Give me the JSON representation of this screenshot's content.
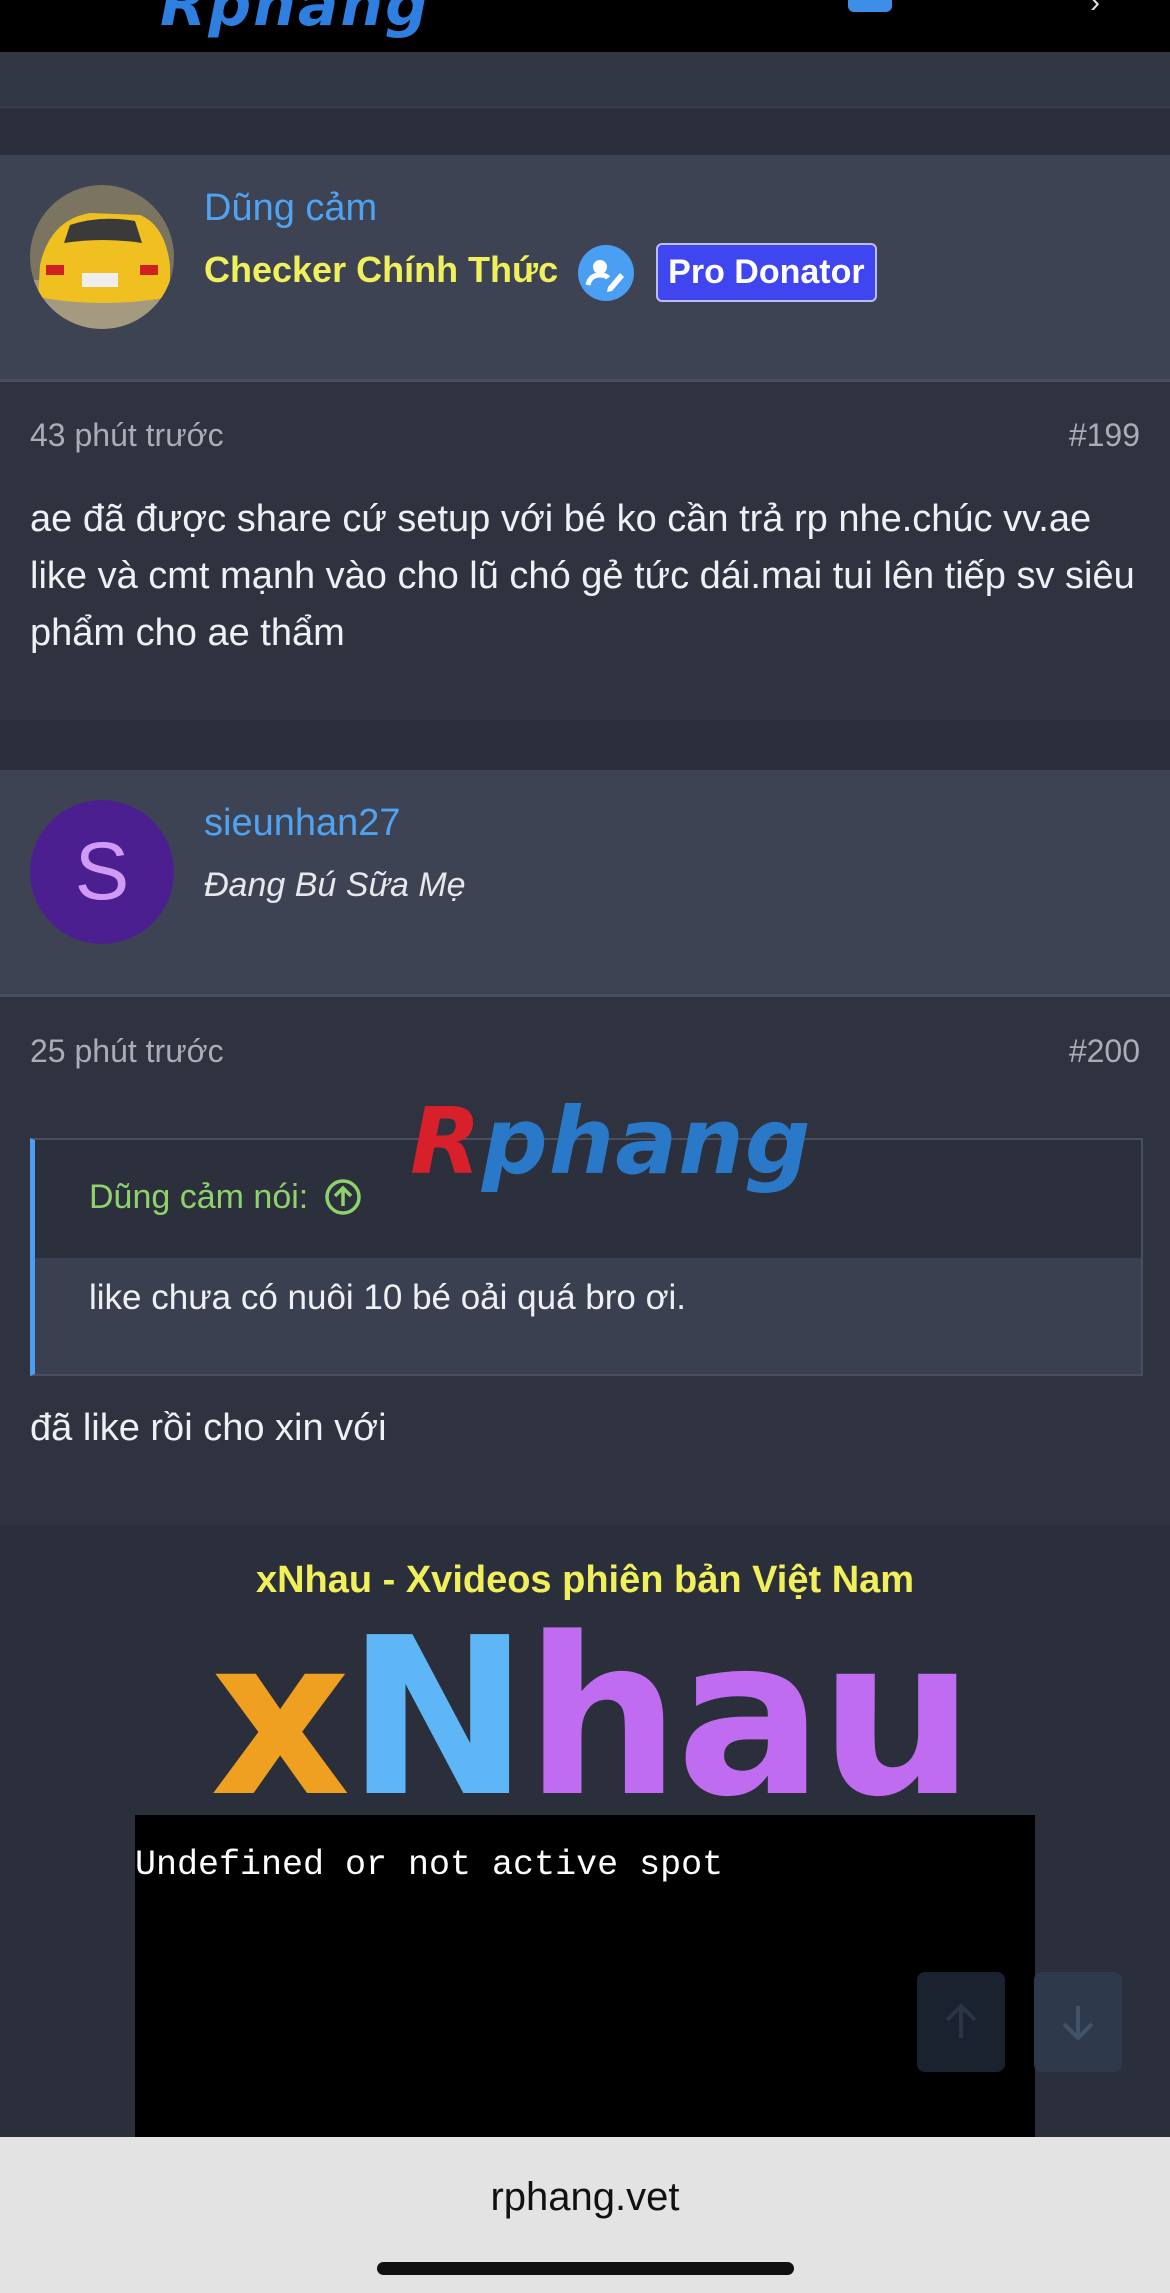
{
  "site": {
    "domain": "rphang.vet",
    "watermark_first": "R",
    "watermark_rest": "phang"
  },
  "posts": [
    {
      "username": "Dũng cảm",
      "user_title": "Checker Chính Thức",
      "badge": "Pro Donator",
      "time": "43 phút trước",
      "post_number": "#199",
      "message": "ae đã được share cứ setup với bé ko cần trả rp nhe.chúc vv.ae like và cmt mạnh vào cho lũ chó gẻ tức dái.mai tui lên tiếp sv siêu phẩm cho ae thẩm"
    },
    {
      "username": "sieunhan27",
      "avatar_letter": "S",
      "user_title": "Đang Bú Sữa Mẹ",
      "time": "25 phút trước",
      "post_number": "#200",
      "quote_author": "Dũng cảm nói:",
      "quote_text": "like chưa có nuôi 10 bé oải quá bro ơi.",
      "message": "đã like rồi cho xin với"
    }
  ],
  "ad": {
    "title": "xNhau - Xvideos phiên bản Việt Nam",
    "logo_x": "x",
    "logo_n": "N",
    "logo_hau": "hau",
    "box_text": "Undefined or not active spot"
  },
  "icons": {
    "verified": "verified-pen-icon",
    "quote_jump": "arrow-up-circle-icon",
    "scroll_up": "arrow-up-icon",
    "scroll_down": "arrow-down-icon"
  },
  "colors": {
    "link": "#4fa3f0",
    "checker": "#f0f05a",
    "badge": "#3f46f0",
    "quote_author": "#8fd16b",
    "avatar_purple": "#4b1f8f"
  }
}
